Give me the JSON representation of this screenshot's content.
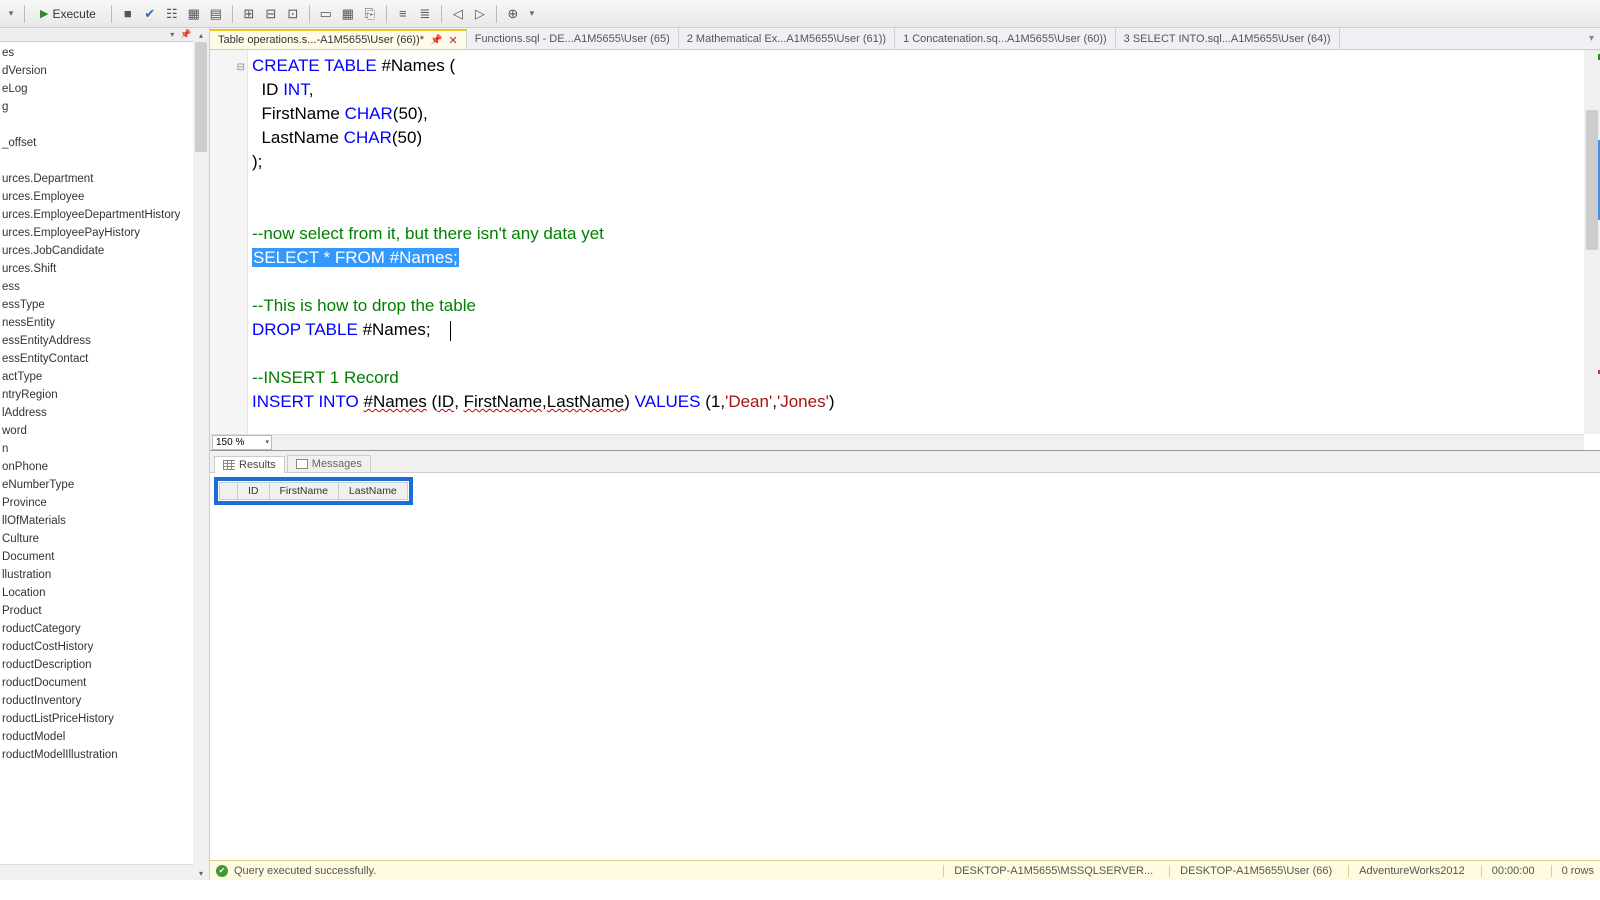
{
  "toolbar": {
    "execute_label": "Execute"
  },
  "tabs": [
    {
      "label": "Table operations.s...-A1M5655\\User (66))*",
      "active": true,
      "pinnable": true,
      "closeable": true
    },
    {
      "label": "Functions.sql - DE...A1M5655\\User (65)",
      "active": false
    },
    {
      "label": "2 Mathematical Ex...A1M5655\\User (61))",
      "active": false
    },
    {
      "label": "1 Concatenation.sq...A1M5655\\User (60))",
      "active": false
    },
    {
      "label": "3 SELECT INTO.sql...A1M5655\\User (64))",
      "active": false
    }
  ],
  "sidebar_items": [
    "es",
    "dVersion",
    "eLog",
    "g",
    "",
    "_offset",
    "",
    "urces.Department",
    "urces.Employee",
    "urces.EmployeeDepartmentHistory",
    "urces.EmployeePayHistory",
    "urces.JobCandidate",
    "urces.Shift",
    "ess",
    "essType",
    "nessEntity",
    "essEntityAddress",
    "essEntityContact",
    "actType",
    "ntryRegion",
    "lAddress",
    "word",
    "n",
    "onPhone",
    "eNumberType",
    "Province",
    "llOfMaterials",
    "Culture",
    "Document",
    "llustration",
    "Location",
    "Product",
    "roductCategory",
    "roductCostHistory",
    "roductDescription",
    "roductDocument",
    "roductInventory",
    "roductListPriceHistory",
    "roductModel",
    "roductModelIllustration"
  ],
  "zoom": "150 %",
  "code": {
    "create": "CREATE TABLE",
    "names": "#Names",
    "id": "ID",
    "int": "INT",
    "first": "FirstName",
    "char": "CHAR",
    "fifty": "50",
    "last": "LastName",
    "comment_select": "--now select from it, but there isn't any data yet",
    "select": "SELECT",
    "star": "*",
    "from": "FROM",
    "comment_drop": "--This is how to drop the table",
    "drop": "DROP TABLE",
    "comment_insert": "--INSERT 1 Record",
    "insert": "INSERT INTO",
    "values": "VALUES",
    "one": "1",
    "dean": "'Dean'",
    "jones": "'Jones'"
  },
  "results_tabs": {
    "results": "Results",
    "messages": "Messages"
  },
  "grid_headers": [
    "ID",
    "FirstName",
    "LastName"
  ],
  "status": {
    "msg": "Query executed successfully.",
    "server": "DESKTOP-A1M5655\\MSSQLSERVER...",
    "user": "DESKTOP-A1M5655\\User (66)",
    "db": "AdventureWorks2012",
    "time": "00:00:00",
    "rows": "0 rows"
  }
}
